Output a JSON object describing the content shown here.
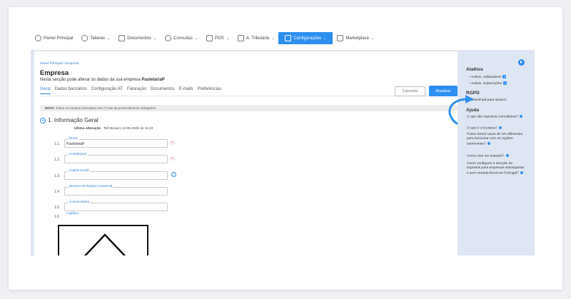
{
  "nav": {
    "items": [
      {
        "label": "Painel Principal",
        "icon": "dashboard-icon"
      },
      {
        "label": "Tabelas",
        "icon": "users-icon",
        "chevron": "⌄"
      },
      {
        "label": "Documentos",
        "icon": "document-icon",
        "chevron": "⌄"
      },
      {
        "label": "Consultas",
        "icon": "clock-icon",
        "chevron": "⌄"
      },
      {
        "label": "POS",
        "icon": "pos-icon",
        "chevron": "⌄"
      },
      {
        "label": "A. Tributária",
        "icon": "tax-icon",
        "chevron": "⌄"
      },
      {
        "label": "Configurações",
        "icon": "settings-icon",
        "chevron": "⌄",
        "active": true
      },
      {
        "label": "Marketplace",
        "icon": "grid-icon",
        "chevron": "⌄"
      }
    ]
  },
  "breadcrumb": "Painel Principal  >  Empresa",
  "page": {
    "title": "Empresa",
    "subtitle_prefix": "Nesta secção pode alterar os dados da sua empresa ",
    "company": "PastelariaP"
  },
  "tabs": [
    "Geral",
    "Dados bancários",
    "Configuração AT",
    "Faturação",
    "Documentos",
    "E-mails",
    "Preferências"
  ],
  "buttons": {
    "cancel": "Cancelar",
    "update": "Atualizar"
  },
  "note": {
    "bold": "NOTA:",
    "text": " Todos os campos marcados com (*) são de preenchimento obrigatório"
  },
  "section": {
    "title": "1. Informação Geral",
    "last_update_label": "Última alteração",
    "last_update_value": "Tofi Bread | 12-05-2025 às 11:24"
  },
  "fields": [
    {
      "num": "1.1.",
      "label": "Nome",
      "value": "PastelariaP",
      "required": "(*)"
    },
    {
      "num": "1.2.",
      "label": "Contribuinte",
      "value": "",
      "required": "(*)"
    },
    {
      "num": "1.3.",
      "label": "Capital Social",
      "value": "",
      "help": "?"
    },
    {
      "num": "1.4.",
      "label": "Número de Registo Comercial",
      "value": ""
    },
    {
      "num": "1.5.",
      "label": "Conservatória",
      "value": ""
    },
    {
      "num": "1.6.",
      "label": "Logótipo"
    }
  ],
  "sidebar": {
    "shortcuts_title": "Atalhos",
    "shortcuts": [
      {
        "label": "• Admin. Utilizadores",
        "badge": "4"
      },
      {
        "label": "• Admin. Subscrições",
        "badge": "1"
      }
    ],
    "rgpd_title": "RGPD",
    "rgpd_item": "Download para arquivo",
    "help_title": "Ajuda",
    "help_items": [
      "O que são impostos cumulativos?",
      "O que é o Ecotaxa?",
      "Posso inserir taxas de IVA diferentes para funcionar com as regiões autónomas?",
      "Como criar um imposto?",
      "Como configurar a isenção de impostos para empresas estrangeiras e sem morada fiscal em Portugal?"
    ]
  },
  "colors": {
    "accent": "#2d8ff0",
    "panel": "#dfe6f3",
    "required": "#e66666"
  }
}
